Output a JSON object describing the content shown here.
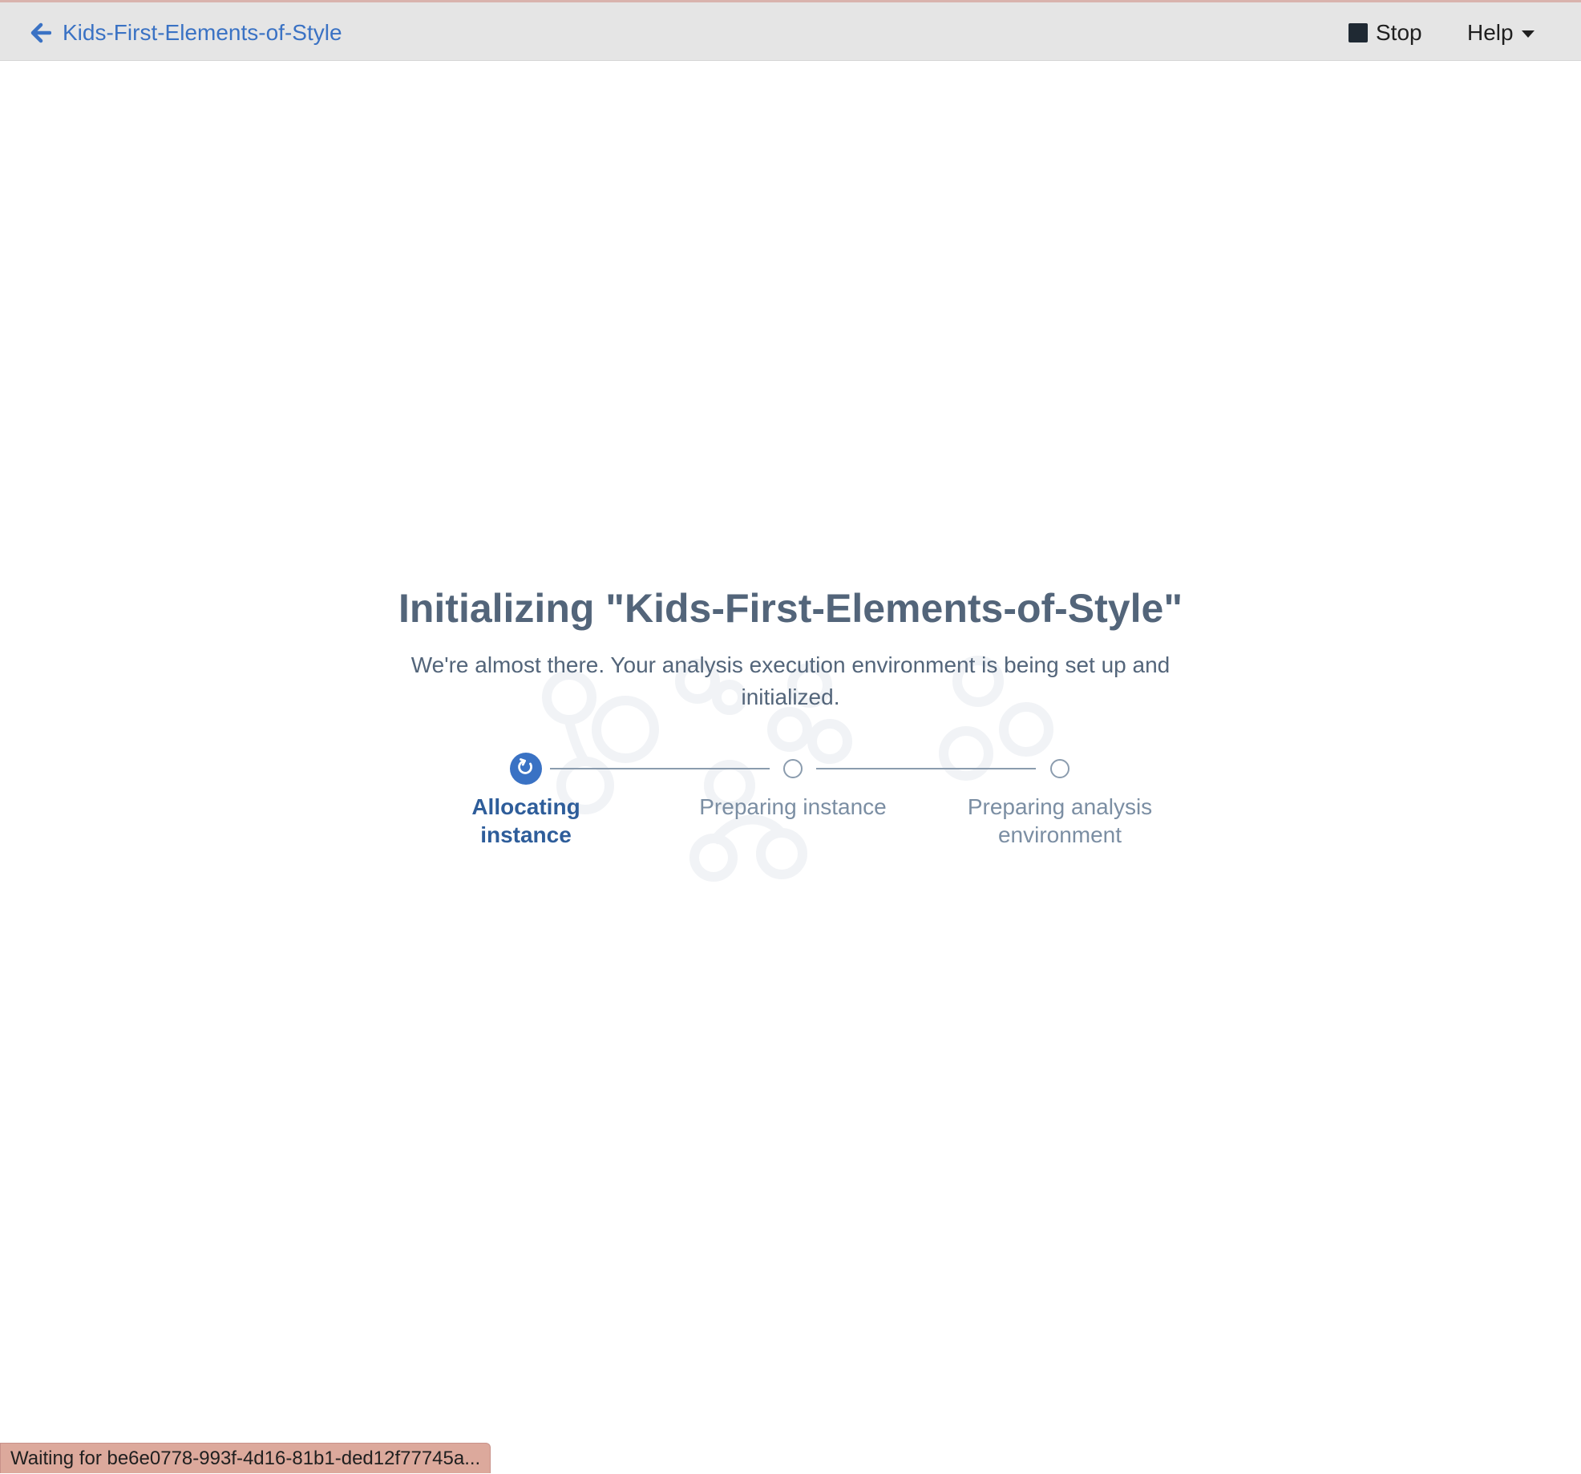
{
  "header": {
    "back_label": "Kids-First-Elements-of-Style",
    "stop_label": "Stop",
    "help_label": "Help"
  },
  "main": {
    "title": "Initializing \"Kids-First-Elements-of-Style\"",
    "subtitle": "We're almost there. Your analysis execution environment is being set up and initialized."
  },
  "steps": [
    {
      "label": "Allocating instance",
      "state": "active"
    },
    {
      "label": "Preparing instance",
      "state": "pending"
    },
    {
      "label": "Preparing analysis environment",
      "state": "pending"
    }
  ],
  "status_bar": {
    "text": "Waiting for be6e0778-993f-4d16-81b1-ded12f77745a..."
  },
  "icons": {
    "back": "arrow-left-icon",
    "stop": "stop-square-icon",
    "help_caret": "caret-down-icon",
    "active_step": "refresh-icon"
  },
  "colors": {
    "link_blue": "#3a72c4",
    "active_step_text": "#2e5d9a",
    "pending_text": "#7b8ea3",
    "title_text": "#53657a",
    "topbar_bg": "#e5e5e5",
    "status_bg": "#dca99c"
  }
}
